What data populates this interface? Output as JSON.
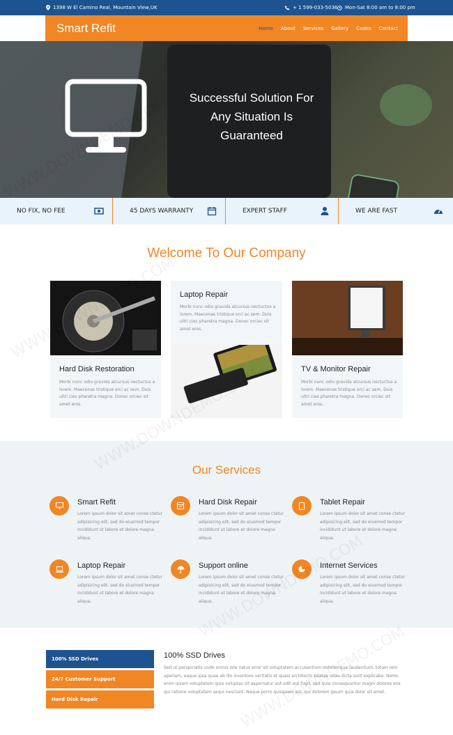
{
  "topbar": {
    "address": "1398 W El Camino Real, Mountain View,UK",
    "phone": "+ 1 599-033-5036",
    "hours": "Mon-Sat 8:00 am to 8:00 pm"
  },
  "header": {
    "brand": "Smart Refit",
    "nav": [
      "Home",
      "About",
      "Services",
      "Gallery",
      "Codes",
      "Contact"
    ],
    "active_color": "#1d5390",
    "accent": "#f18624"
  },
  "hero": {
    "headline": "Successful Solution For Any Situation Is Guaranteed",
    "icon": "monitor-icon"
  },
  "features": [
    {
      "label": "NO FIX, NO FEE",
      "icon": "money-icon"
    },
    {
      "label": "45 DAYS WARRANTY",
      "icon": "calendar-icon"
    },
    {
      "label": "EXPERT STAFF",
      "icon": "user-icon"
    },
    {
      "label": "WE ARE FAST",
      "icon": "speedometer-icon"
    }
  ],
  "welcome": {
    "title": "Welcome To Our Company",
    "cards": [
      {
        "title": "Hard Disk Restoration",
        "text": "Morbi nunc odio gravida atcursus nectuctus a lorem. Maecenas tristique orci ac sem. Duis ultri cies pharetra magna. Donec orciec sit amet eros."
      },
      {
        "title": "Laptop Repair",
        "text": "Morbi nunc odio gravida atcursus nectuctus a lorem. Maecenas tristique orci ac sem. Duis ultri cies pharetra magna. Donec orciec sit amet eros."
      },
      {
        "title": "TV & Monitor Repair",
        "text": "Morbi nunc odio gravida atcursus nectuctus a lorem. Maecenas tristique orci ac sem. Duis ultri cies pharetra magna. Donec orciec sit amet eros."
      }
    ]
  },
  "services": {
    "title": "Our Services",
    "items": [
      {
        "title": "Smart Refit",
        "icon": "desktop-icon",
        "text": "Lorem ipsum dolor sit amet conse ctetur adipisicing elit, sed do eiusmod tempor incididunt ut labore et dolore magna aliqua."
      },
      {
        "title": "Hard Disk Repair",
        "icon": "harddisk-icon",
        "text": "Lorem ipsum dolor sit amet conse ctetur adipisicing elit, sed do eiusmod tempor incididunt ut labore et dolore magna aliqua."
      },
      {
        "title": "Tablet Repair",
        "icon": "tablet-icon",
        "text": "Lorem ipsum dolor sit amet conse ctetur adipisicing elit, sed do eiusmod tempor incididunt ut labore et dolore magna aliqua."
      },
      {
        "title": "Laptop Repair",
        "icon": "laptop-icon",
        "text": "Lorem ipsum dolor sit amet conse ctetur adipisicing elit, sed do eiusmod tempor incididunt ut labore et dolore magna aliqua."
      },
      {
        "title": "Support online",
        "icon": "umbrella-icon",
        "text": "Lorem ipsum dolor sit amet conse ctetur adipisicing elit, sed do eiusmod tempor incididunt ut labore et dolore magna aliqua."
      },
      {
        "title": "Internet Services",
        "icon": "pie-icon",
        "text": "Lorem ipsum dolor sit amet conse ctetur adipisicing elit, sed do eiusmod tempor incididunt ut labore et dolore magna aliqua."
      }
    ]
  },
  "tabs": {
    "items": [
      "100% SSD Drives",
      "24/7 Customer Support",
      "Hard Disk Repair"
    ],
    "active_title": "100% SSD Drives",
    "active_text": "Sed ut perspiciatis unde omnis iste natus error sit voluptatem accusantium doloremque laudantium, totam rem aperiam, eaque ipsa quae ab illo inventore veritatis et quasi architecto beatae vitae dicta sunt explicabo. Nemo enim ipsam voluptatem quia voluptas sit aspernatur aut odit aut fugit, sed quia consequuntur magni dolores eos qui ratione voluptatem sequi nesciunt. Neque porro quisquam est, qui dolorem ipsum quia dolor sit amet."
  },
  "watermark": "WWW.DOWNDEMO.COM"
}
